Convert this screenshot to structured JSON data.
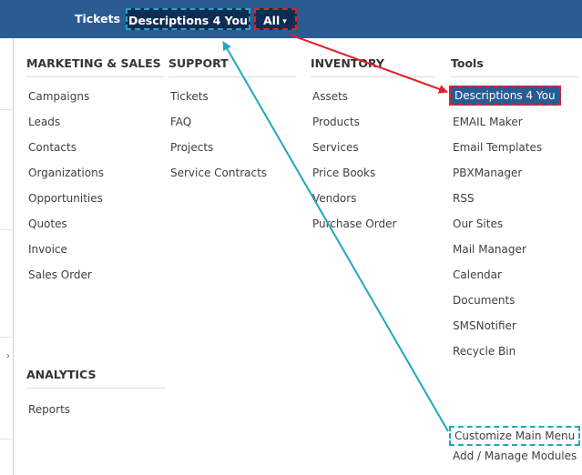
{
  "top_tabs": [
    {
      "label": "Tickets"
    },
    {
      "label": "Descriptions 4 You"
    },
    {
      "label": "All"
    }
  ],
  "caret_glyph": "▾",
  "columns": {
    "marketing": {
      "header": "MARKETING & SALES",
      "items": [
        "Campaigns",
        "Leads",
        "Contacts",
        "Organizations",
        "Opportunities",
        "Quotes",
        "Invoice",
        "Sales Order"
      ]
    },
    "support": {
      "header": "SUPPORT",
      "items": [
        "Tickets",
        "FAQ",
        "Projects",
        "Service Contracts"
      ]
    },
    "inventory": {
      "header": "INVENTORY",
      "items": [
        "Assets",
        "Products",
        "Services",
        "Price Books",
        "Vendors",
        "Purchase Order"
      ]
    },
    "tools": {
      "header": "Tools",
      "items": [
        "Descriptions 4 You",
        "EMAIL Maker",
        "Email Templates",
        "PBXManager",
        "RSS",
        "Our Sites",
        "Mail Manager",
        "Calendar",
        "Documents",
        "SMSNotifier",
        "Recycle Bin"
      ]
    },
    "analytics": {
      "header": "ANALYTICS",
      "items": [
        "Reports"
      ]
    }
  },
  "footer_links": {
    "customize": "Customize Main Menu",
    "manage": "Add / Manage Modules"
  },
  "colors": {
    "nav_bg": "#2b5b93",
    "active_tab_bg": "#0f2d52",
    "highlight_red": "#e0212a",
    "highlight_teal": "#1fa8c1"
  }
}
